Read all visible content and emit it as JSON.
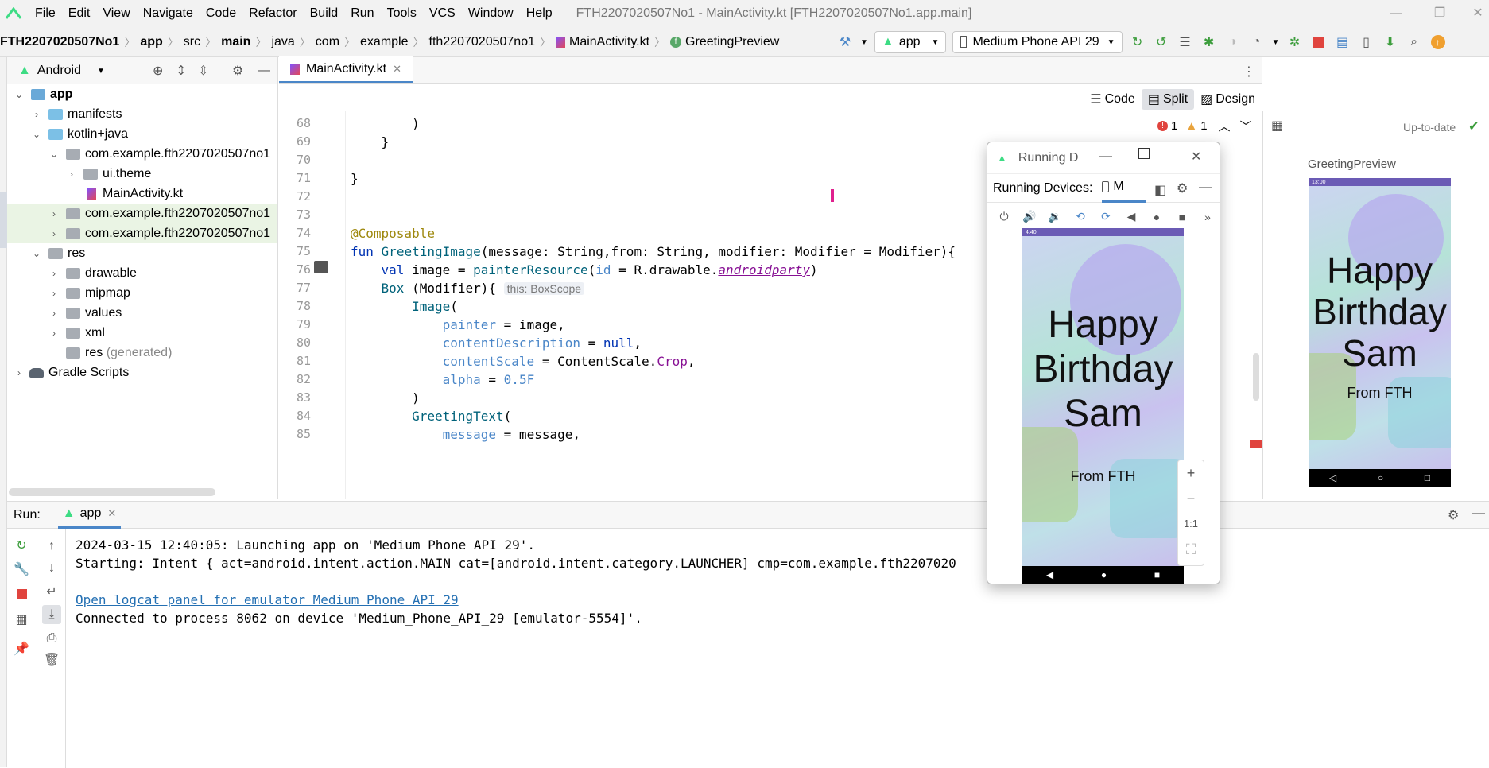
{
  "window": {
    "title": "FTH2207020507No1 - MainActivity.kt [FTH2207020507No1.app.main]",
    "controls": {
      "minimize": "—",
      "restore": "❐",
      "close": "✕"
    }
  },
  "menu": [
    "File",
    "Edit",
    "View",
    "Navigate",
    "Code",
    "Refactor",
    "Build",
    "Run",
    "Tools",
    "VCS",
    "Window",
    "Help"
  ],
  "breadcrumbs": [
    "FTH2207020507No1",
    "app",
    "src",
    "main",
    "java",
    "com",
    "example",
    "fth2207020507no1",
    "MainActivity.kt",
    "GreetingPreview"
  ],
  "toolbar": {
    "run_config": "app",
    "device": "Medium Phone API 29"
  },
  "project": {
    "view_label": "Android",
    "tree": [
      {
        "label": "app",
        "bold": true
      },
      {
        "label": "manifests"
      },
      {
        "label": "kotlin+java"
      },
      {
        "label": "com.example.fth2207020507no1"
      },
      {
        "label": "ui.theme"
      },
      {
        "label": "MainActivity.kt"
      },
      {
        "label": "com.example.fth2207020507no1"
      },
      {
        "label": "com.example.fth2207020507no1"
      },
      {
        "label": "res"
      },
      {
        "label": "drawable"
      },
      {
        "label": "mipmap"
      },
      {
        "label": "values"
      },
      {
        "label": "xml"
      },
      {
        "label": "res",
        "suffix": "(generated)"
      },
      {
        "label": "Gradle Scripts"
      }
    ]
  },
  "editor": {
    "tab": "MainActivity.kt",
    "view_modes": [
      "Code",
      "Split",
      "Design"
    ],
    "active_mode": "Split",
    "inspection": {
      "errors": "1",
      "warnings": "1"
    },
    "status": "Up-to-date",
    "line_numbers": [
      "68",
      "69",
      "70",
      "71",
      "72",
      "73",
      "74",
      "75",
      "76",
      "77",
      "78",
      "79",
      "80",
      "81",
      "82",
      "83",
      "84",
      "85"
    ],
    "inlay_hint": "this: BoxScope"
  },
  "preview": {
    "label": "GreetingPreview",
    "status_time": "13:00",
    "text1": "Happy",
    "text2": "Birthday",
    "text3": "Sam",
    "from": "From FTH"
  },
  "running_devices": {
    "window_title": "Running D",
    "panel_label": "Running Devices:",
    "tab": "M",
    "status_time": "4:40",
    "zoom_controls": [
      "+",
      "−",
      "1:1",
      "⛶"
    ],
    "text1": "Happy",
    "text2": "Birthday",
    "text3": "Sam",
    "from": "From FTH"
  },
  "run": {
    "label": "Run:",
    "tab": "app",
    "console": [
      "2024-03-15 12:40:05: Launching app on 'Medium Phone API 29'.",
      "Starting: Intent { act=android.intent.action.MAIN cat=[android.intent.category.LAUNCHER] cmp=com.example.fth2207020",
      "",
      "Open logcat panel for emulator Medium Phone API 29",
      "Connected to process 8062 on device 'Medium_Phone_API_29 [emulator-5554]'."
    ]
  },
  "colors": {
    "accent": "#4a86c8",
    "android_green": "#3ddc84",
    "stop_red": "#e0443e"
  }
}
